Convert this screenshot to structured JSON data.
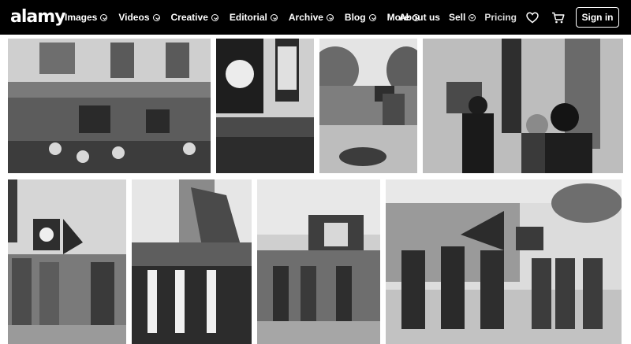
{
  "header": {
    "logo": "alamy",
    "nav": [
      {
        "label": "Images"
      },
      {
        "label": "Videos"
      },
      {
        "label": "Creative"
      },
      {
        "label": "Editorial"
      },
      {
        "label": "Archive"
      },
      {
        "label": "Blog"
      },
      {
        "label": "More"
      }
    ],
    "about": "About us",
    "sell": "Sell",
    "pricing": "Pricing",
    "signin": "Sign in",
    "icons": {
      "favorites": "heart-icon",
      "cart": "cart-icon",
      "chevron": "chevron-down-icon"
    }
  },
  "results": {
    "images": [
      {
        "name": "result-image-1"
      },
      {
        "name": "result-image-2"
      },
      {
        "name": "result-image-3"
      },
      {
        "name": "result-image-4"
      },
      {
        "name": "result-image-5"
      },
      {
        "name": "result-image-6"
      },
      {
        "name": "result-image-7"
      },
      {
        "name": "result-image-8"
      }
    ]
  },
  "colors": {
    "header_bg": "#000000",
    "header_text": "#ffffff"
  }
}
